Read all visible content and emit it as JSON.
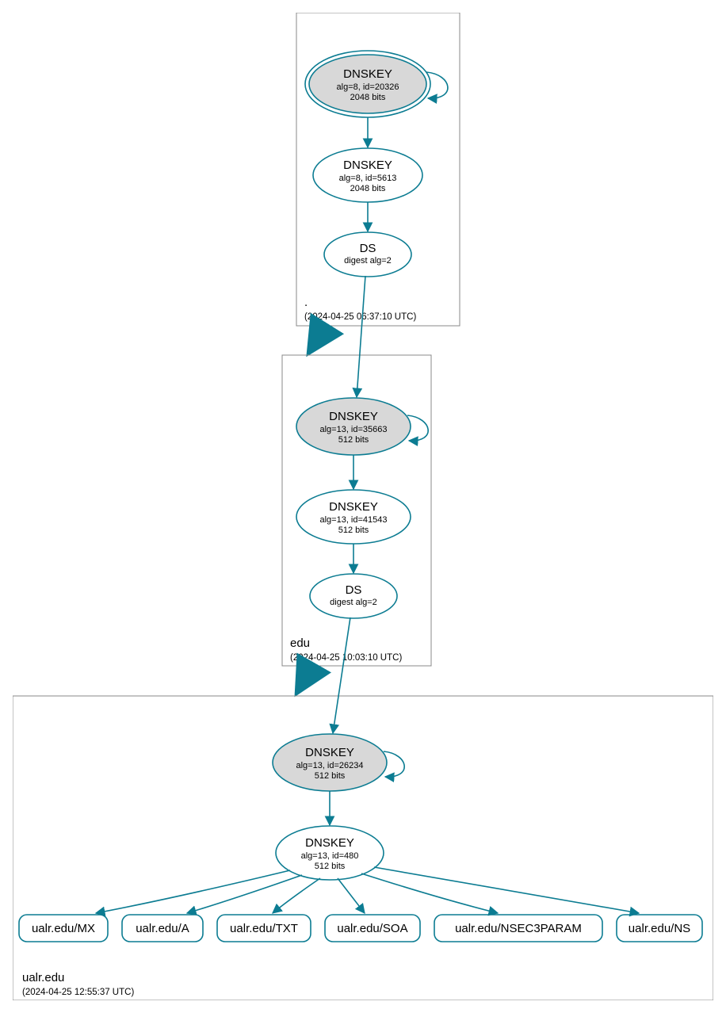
{
  "colors": {
    "edge": "#0c7c92",
    "ksk_fill": "#d8d8d8"
  },
  "zones": [
    {
      "name": ".",
      "timestamp": "(2024-04-25 06:37:10 UTC)",
      "nodes": [
        {
          "id": "root_ksk",
          "type": "dnskey",
          "ksk": true,
          "double": true,
          "self_loop": true,
          "lines": [
            "DNSKEY",
            "alg=8, id=20326",
            "2048 bits"
          ]
        },
        {
          "id": "root_zsk",
          "type": "dnskey",
          "lines": [
            "DNSKEY",
            "alg=8, id=5613",
            "2048 bits"
          ]
        },
        {
          "id": "root_ds",
          "type": "ds",
          "lines": [
            "DS",
            "digest alg=2"
          ]
        }
      ]
    },
    {
      "name": "edu",
      "timestamp": "(2024-04-25 10:03:10 UTC)",
      "nodes": [
        {
          "id": "edu_ksk",
          "type": "dnskey",
          "ksk": true,
          "self_loop": true,
          "lines": [
            "DNSKEY",
            "alg=13, id=35663",
            "512 bits"
          ]
        },
        {
          "id": "edu_zsk",
          "type": "dnskey",
          "lines": [
            "DNSKEY",
            "alg=13, id=41543",
            "512 bits"
          ]
        },
        {
          "id": "edu_ds",
          "type": "ds",
          "lines": [
            "DS",
            "digest alg=2"
          ]
        }
      ]
    },
    {
      "name": "ualr.edu",
      "timestamp": "(2024-04-25 12:55:37 UTC)",
      "nodes": [
        {
          "id": "ualr_ksk",
          "type": "dnskey",
          "ksk": true,
          "self_loop": true,
          "lines": [
            "DNSKEY",
            "alg=13, id=26234",
            "512 bits"
          ]
        },
        {
          "id": "ualr_zsk",
          "type": "dnskey",
          "lines": [
            "DNSKEY",
            "alg=13, id=480",
            "512 bits"
          ]
        }
      ],
      "rrsets": [
        "ualr.edu/MX",
        "ualr.edu/A",
        "ualr.edu/TXT",
        "ualr.edu/SOA",
        "ualr.edu/NSEC3PARAM",
        "ualr.edu/NS"
      ]
    }
  ]
}
